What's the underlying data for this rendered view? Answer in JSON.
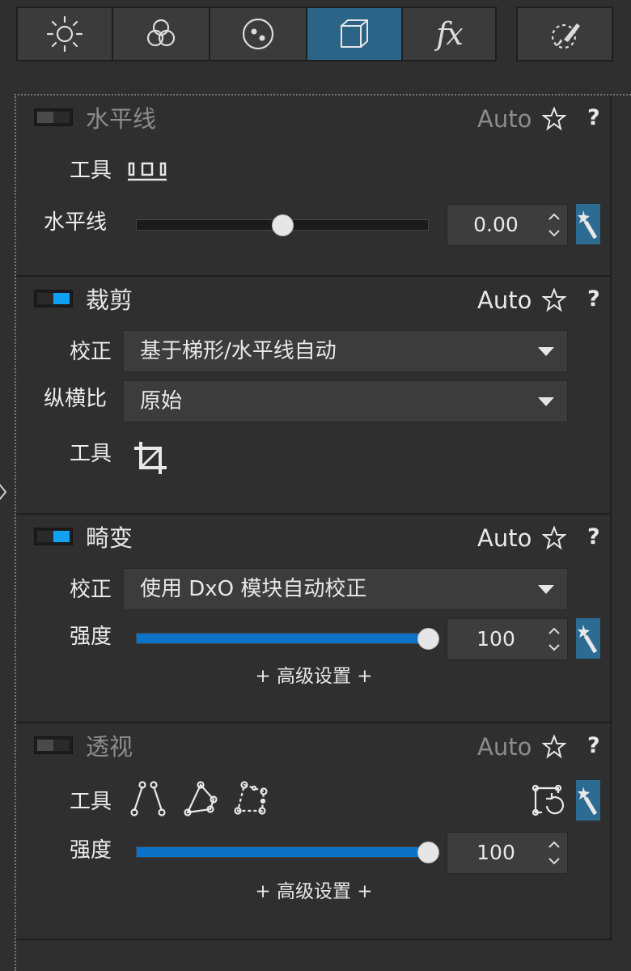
{
  "toolbar": {
    "tabs": [
      {
        "icon": "sun-icon"
      },
      {
        "icon": "color-circles-icon"
      },
      {
        "icon": "detail-dots-icon"
      },
      {
        "icon": "geometry-cube-icon",
        "active": true
      },
      {
        "icon": "fx-icon",
        "label": "fx"
      },
      {
        "icon": "local-adjust-brush-icon"
      }
    ]
  },
  "sections": {
    "horizon": {
      "title": "水平线",
      "enabled": false,
      "auto": "Auto",
      "help": "?",
      "tool_label": "工具",
      "slider_label": "水平线",
      "slider_value": "0.00",
      "slider_position": 0.5
    },
    "crop": {
      "title": "裁剪",
      "enabled": true,
      "auto": "Auto",
      "help": "?",
      "correction_label": "校正",
      "correction_value": "基于梯形/水平线自动",
      "aspect_label": "纵横比",
      "aspect_value": "原始",
      "tool_label": "工具"
    },
    "distortion": {
      "title": "畸变",
      "enabled": true,
      "auto": "Auto",
      "help": "?",
      "correction_label": "校正",
      "correction_value": "使用 DxO 模块自动校正",
      "strength_label": "强度",
      "strength_value": "100",
      "strength_position": 1.0,
      "advanced": "+ 高级设置 +"
    },
    "perspective": {
      "title": "透视",
      "enabled": false,
      "auto": "Auto",
      "help": "?",
      "tool_label": "工具",
      "strength_label": "强度",
      "strength_value": "100",
      "strength_position": 1.0,
      "advanced": "+ 高级设置 +"
    }
  },
  "colors": {
    "accent": "#12a0f0",
    "active_tab": "#2c6488",
    "slider_fill": "#0c72c8"
  }
}
